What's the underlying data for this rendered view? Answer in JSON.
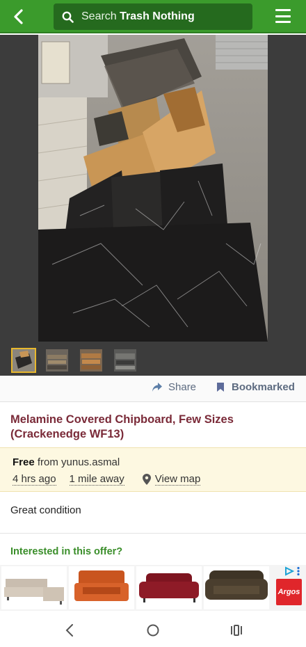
{
  "header": {
    "search_prefix": "Search",
    "search_brand": "Trash Nothing"
  },
  "actions": {
    "share_label": "Share",
    "bookmark_label": "Bookmarked"
  },
  "listing": {
    "title": "Melamine Covered Chipboard, Few Sizes (Crackenedge WF13)",
    "price_label": "Free",
    "from_text": "from yunus.asmal",
    "posted": "4 hrs ago",
    "distance": "1 mile away",
    "view_map": "View map",
    "description": "Great condition"
  },
  "interest": {
    "heading": "Interested in this offer?"
  },
  "ad": {
    "brand": "Argos"
  },
  "colors": {
    "brand_green": "#3b9b2c",
    "title_maroon": "#7a2a38",
    "info_bg": "#fdf8e1",
    "thumb_active": "#e8b82d"
  }
}
